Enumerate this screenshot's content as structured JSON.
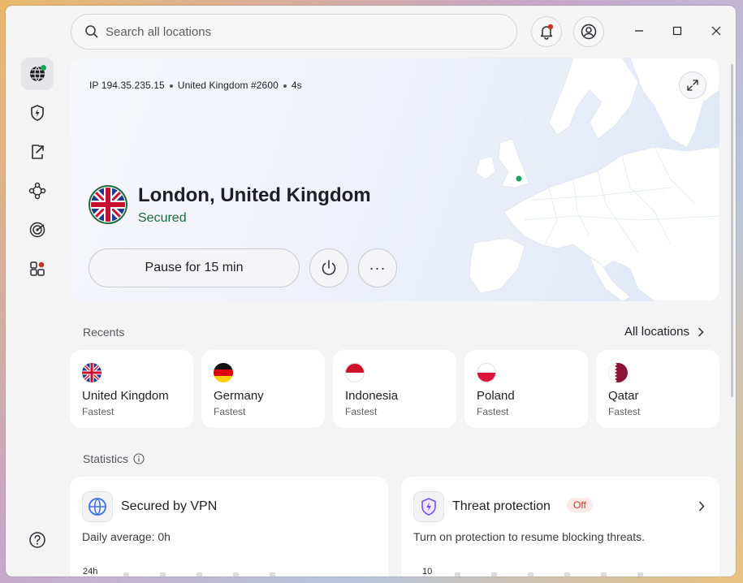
{
  "search": {
    "placeholder": "Search all locations"
  },
  "connection": {
    "ip_line": "IP 194.35.235.15",
    "server": "United Kingdom #2600",
    "duration": "4s",
    "location_title": "London, United Kingdom",
    "status": "Secured",
    "pause_label": "Pause for 15 min",
    "more_label": "···"
  },
  "recents": {
    "label": "Recents",
    "all_locations_label": "All locations",
    "items": [
      {
        "country": "United Kingdom",
        "sub": "Fastest",
        "flag": "uk"
      },
      {
        "country": "Germany",
        "sub": "Fastest",
        "flag": "de"
      },
      {
        "country": "Indonesia",
        "sub": "Fastest",
        "flag": "id"
      },
      {
        "country": "Poland",
        "sub": "Fastest",
        "flag": "pl"
      },
      {
        "country": "Qatar",
        "sub": "Fastest",
        "flag": "qa"
      }
    ]
  },
  "statistics": {
    "label": "Statistics",
    "vpn": {
      "title": "Secured by VPN",
      "daily_average": "Daily average: 0h",
      "axis_top": "24h"
    },
    "threat": {
      "title": "Threat protection",
      "badge": "Off",
      "message": "Turn on protection to resume blocking threats.",
      "axis_top": "10"
    }
  },
  "colors": {
    "secured_green": "#1e6b3a",
    "accent_green": "#1aa260",
    "badge_red": "#c0392b"
  }
}
